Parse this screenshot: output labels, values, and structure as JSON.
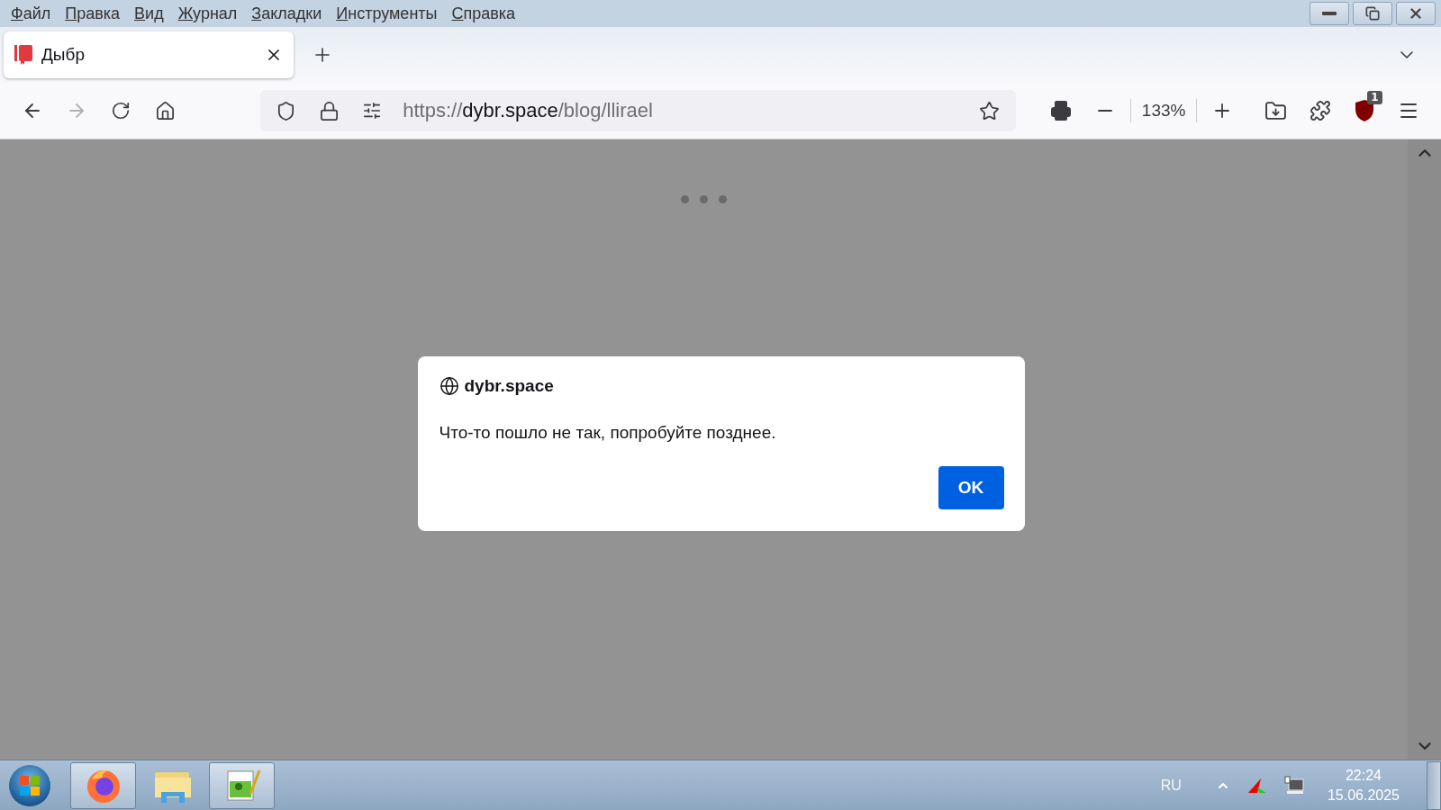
{
  "menu": [
    {
      "label": "Файл"
    },
    {
      "label": "Правка"
    },
    {
      "label": "Вид"
    },
    {
      "label": "Журнал"
    },
    {
      "label": "Закладки"
    },
    {
      "label": "Инструменты"
    },
    {
      "label": "Справка"
    }
  ],
  "tabs": [
    {
      "title": "Дыбр",
      "selected": true
    }
  ],
  "nav": {
    "forward_disabled": true,
    "url": {
      "scheme": "https://",
      "host": "dybr.space",
      "path": "/blog/llirael"
    },
    "zoom": "133%",
    "extension_badge": "1"
  },
  "dialog": {
    "origin": "dybr.space",
    "message": "Что-то пошло не так, попробуйте позднее.",
    "button": "OK"
  },
  "taskbar": {
    "apps": [
      {
        "kind": "firefox",
        "running": true
      },
      {
        "kind": "explorer",
        "running": false
      },
      {
        "kind": "notepad",
        "running": true
      }
    ],
    "language": "RU",
    "time": "22:24",
    "date": "15.06.2025"
  }
}
